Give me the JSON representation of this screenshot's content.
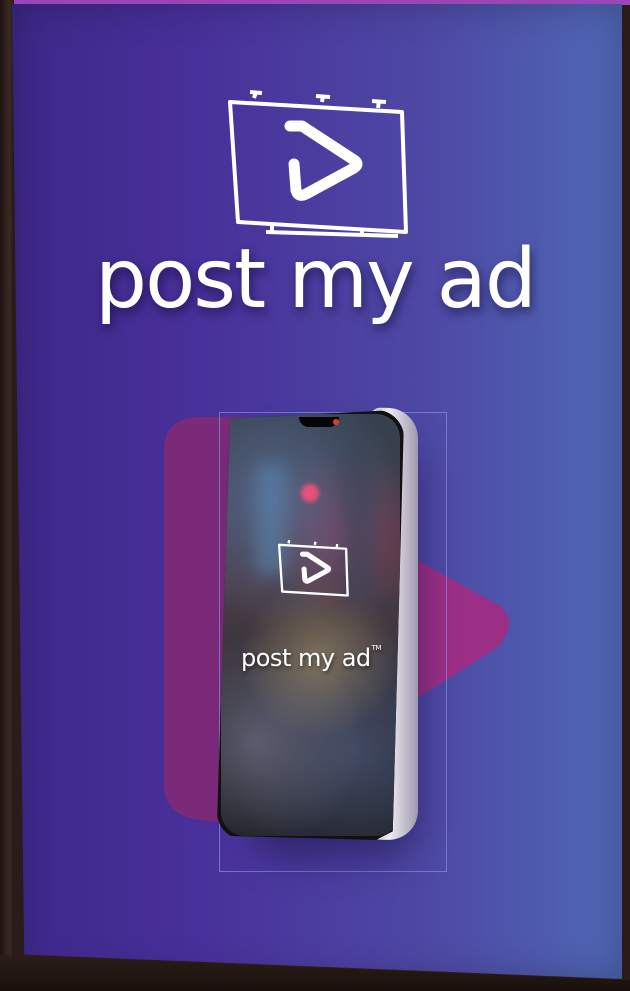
{
  "brand": {
    "name": "post my ad",
    "phone_brand": "post my ad",
    "trademark": "TM"
  },
  "colors": {
    "background_left": "#3e2889",
    "background_right": "#4f68b6",
    "accent_magenta": "#9b2f86",
    "logo_white": "#ffffff"
  },
  "icons": {
    "logo": "billboard-play-icon",
    "phone_logo": "billboard-play-icon",
    "background_shape": "play-triangle-shape"
  }
}
